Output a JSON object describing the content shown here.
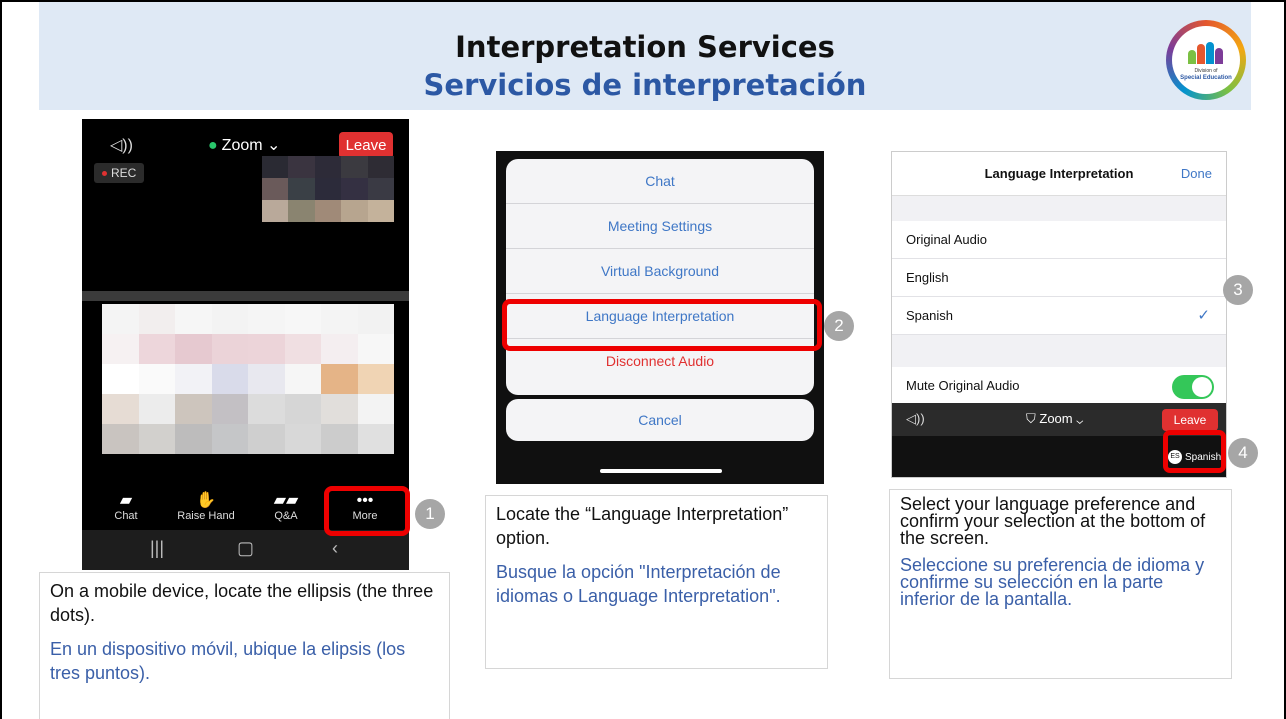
{
  "header": {
    "title_en": "Interpretation Services",
    "title_es": "Servicios de interpretación",
    "logo_line1": "Division of",
    "logo_line2": "Special Education"
  },
  "step1": {
    "number": "1",
    "phone": {
      "leave_label": "Leave",
      "app_label": "Zoom",
      "rec_label": "REC",
      "toolbar": [
        {
          "label": "Chat",
          "icon": "chat-icon"
        },
        {
          "label": "Raise Hand",
          "icon": "hand-icon"
        },
        {
          "label": "Q&A",
          "icon": "qa-icon"
        },
        {
          "label": "More",
          "icon": "ellipsis-icon"
        }
      ]
    },
    "caption_en": "On a mobile device, locate the ellipsis (the three dots).",
    "caption_es": "En un dispositivo móvil, ubique la elipsis (los tres puntos)."
  },
  "step2": {
    "number": "2",
    "menu": [
      "Chat",
      "Meeting Settings",
      "Virtual Background",
      "Language Interpretation",
      "Disconnect Audio"
    ],
    "cancel_label": "Cancel",
    "caption_en": "Locate  the “Language Interpretation” option.",
    "caption_es": "Busque la opción \"Interpretación de idiomas o Language Interpretation\"."
  },
  "step3": {
    "number": "3",
    "title": "Language Interpretation",
    "done_label": "Done",
    "options": [
      "Original Audio",
      "English",
      "Spanish"
    ],
    "selected_option": "Spanish",
    "mute_label": "Mute Original Audio",
    "mute_on": true,
    "bar_app_label": "Zoom",
    "bar_leave_label": "Leave",
    "caption_en": "Select your language preference and confirm your selection at the bottom of the screen.",
    "caption_es": "Seleccione su preferencia de idioma y confirme su selección en la parte inferior de la pantalla."
  },
  "step4": {
    "number": "4",
    "badge_code": "ES",
    "badge_label": "Spanish"
  }
}
